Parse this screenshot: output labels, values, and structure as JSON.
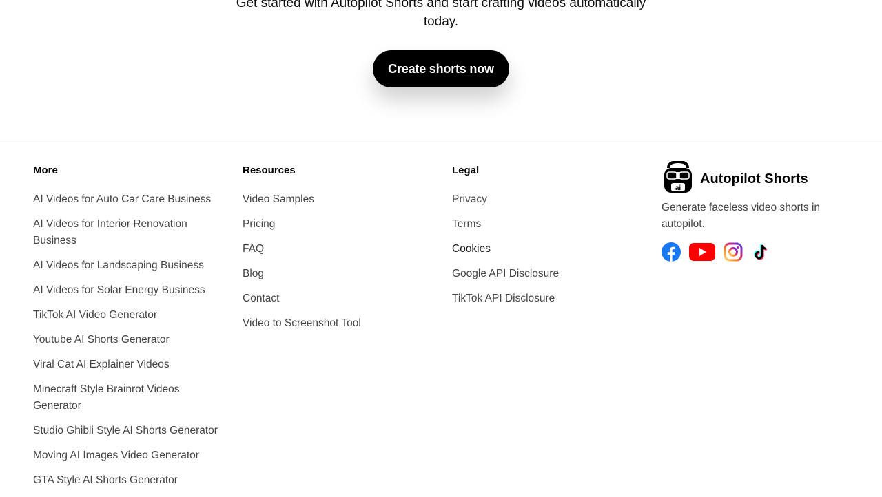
{
  "cta": {
    "text": "Get started with Autopilot Shorts and start crafting videos automatically today.",
    "button_label": "Create shorts now"
  },
  "footer": {
    "more": {
      "heading": "More",
      "links": [
        "AI Videos for Auto Car Care Business",
        "AI Videos for Interior Renovation Business",
        "AI Videos for Landscaping Business",
        "AI Videos for Solar Energy Business",
        "TikTok AI Video Generator",
        "Youtube AI Shorts Generator",
        "Viral Cat AI Explainer Videos",
        "Minecraft Style Brainrot Videos Generator",
        "Studio Ghibli Style AI Shorts Generator",
        "Moving AI Images Video Generator",
        "GTA Style AI Shorts Generator"
      ]
    },
    "resources": {
      "heading": "Resources",
      "links": [
        "Video Samples",
        "Pricing",
        "FAQ",
        "Blog",
        "Contact",
        "Video to Screenshot Tool"
      ]
    },
    "legal": {
      "heading": "Legal",
      "links": [
        "Privacy",
        "Terms",
        "Cookies",
        "Google API Disclosure",
        "TikTok API Disclosure"
      ]
    },
    "brand": {
      "name": "Autopilot Shorts",
      "logo_text": "ai",
      "description": "Generate faceless video shorts in autopilot."
    },
    "socials": [
      "facebook-icon",
      "youtube-icon",
      "instagram-icon",
      "tiktok-icon"
    ]
  },
  "colors": {
    "facebook": "#1877F2",
    "youtube": "#FF0000",
    "button_bg": "#000000",
    "link_text": "#444444"
  }
}
